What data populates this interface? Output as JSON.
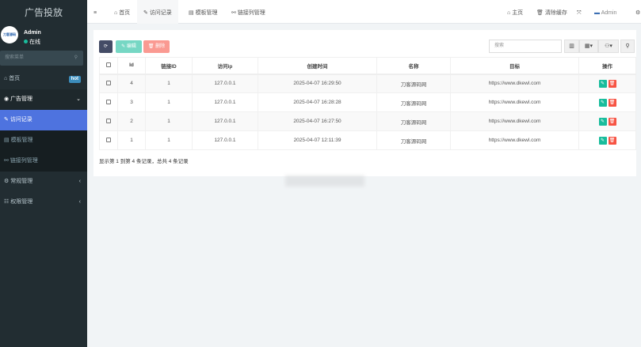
{
  "sidebar": {
    "title": "广告投放",
    "avatar_text": "刀客源码",
    "user": "Admin",
    "status": "在线",
    "search_placeholder": "搜索菜单",
    "items": [
      {
        "label": "首页",
        "badge": "hot"
      },
      {
        "label": "广告管理"
      },
      {
        "label": "访问记录"
      },
      {
        "label": "模板管理"
      },
      {
        "label": "链接列管理"
      },
      {
        "label": "常规管理"
      },
      {
        "label": "权限管理"
      }
    ]
  },
  "tabs": [
    {
      "label": "首页"
    },
    {
      "label": "访问记录"
    },
    {
      "label": "模板管理"
    },
    {
      "label": "链接列管理"
    }
  ],
  "topnav": {
    "home": "主页",
    "clear_cache": "清除缓存",
    "user": "Admin"
  },
  "toolbar": {
    "edit": "编辑",
    "delete": "删除",
    "search_placeholder": "搜索"
  },
  "table": {
    "headers": [
      "Id",
      "链接ID",
      "访问ip",
      "创建时间",
      "名称",
      "目标",
      "操作"
    ],
    "rows": [
      {
        "id": "4",
        "link_id": "1",
        "ip": "127.0.0.1",
        "created": "2025-04-07 16:29:50",
        "name": "刀客源码网",
        "target": "https://www.dkewl.com"
      },
      {
        "id": "3",
        "link_id": "1",
        "ip": "127.0.0.1",
        "created": "2025-04-07 16:28:28",
        "name": "刀客源码网",
        "target": "https://www.dkewl.com"
      },
      {
        "id": "2",
        "link_id": "1",
        "ip": "127.0.0.1",
        "created": "2025-04-07 16:27:50",
        "name": "刀客源码网",
        "target": "https://www.dkewl.com"
      },
      {
        "id": "1",
        "link_id": "1",
        "ip": "127.0.0.1",
        "created": "2025-04-07 12:11:39",
        "name": "刀客源码网",
        "target": "https://www.dkewl.com"
      }
    ]
  },
  "footer": "显示第 1 到第 4 条记录，总共 4 条记录",
  "colors": {
    "sidebar": "#222d32",
    "active": "#4e73df",
    "edit": "#1abc9c",
    "delete": "#f75444",
    "refresh": "#444c66"
  }
}
